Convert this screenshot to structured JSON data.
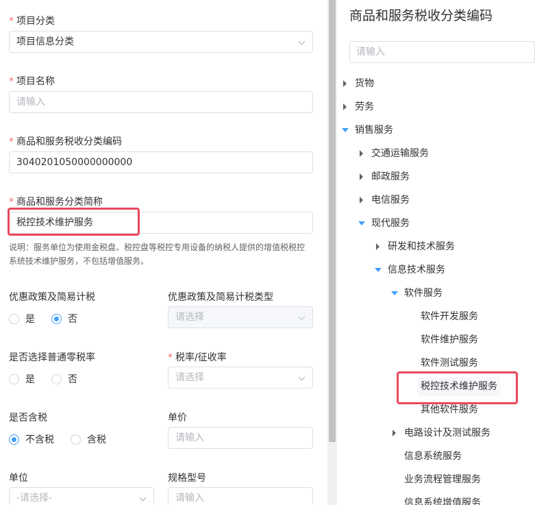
{
  "form": {
    "category": {
      "label": "项目分类",
      "value": "项目信息分类"
    },
    "name": {
      "label": "项目名称",
      "placeholder": "请输入"
    },
    "tax_code": {
      "label": "商品和服务税收分类编码",
      "value": "3040201050000000000"
    },
    "short_name": {
      "label": "商品和服务分类简称",
      "value": "税控技术维护服务"
    },
    "note": [
      "说明：服务单位为使用金税盘、税控盘等税控专用设备的纳税人提供的增值税税控",
      "系统技术维护服务，不包括增值服务。"
    ],
    "preferential": {
      "label": "优惠政策及简易计税",
      "options": [
        "是",
        "否"
      ],
      "selected": "否"
    },
    "preferential_type": {
      "label": "优惠政策及简易计税类型",
      "placeholder": "请选择"
    },
    "zero_rate": {
      "label": "是否选择普通零税率",
      "options": [
        "是",
        "否"
      ],
      "selected": ""
    },
    "tax_rate": {
      "label": "税率/征收率",
      "placeholder": "请选择"
    },
    "tax_included": {
      "label": "是否含税",
      "options": [
        "不含税",
        "含税"
      ],
      "selected": "不含税"
    },
    "unit_price": {
      "label": "单价",
      "placeholder": "请输入"
    },
    "unit": {
      "label": "单位",
      "placeholder": "-请选择-"
    },
    "spec": {
      "label": "规格型号",
      "placeholder": "请输入"
    }
  },
  "tree_panel": {
    "title": "商品和服务税收分类编码",
    "search_placeholder": "请输入",
    "nodes": [
      {
        "label": "货物",
        "level": 0,
        "state": "collapsed"
      },
      {
        "label": "劳务",
        "level": 0,
        "state": "collapsed"
      },
      {
        "label": "销售服务",
        "level": 0,
        "state": "expanded"
      },
      {
        "label": "交通运输服务",
        "level": 1,
        "state": "collapsed"
      },
      {
        "label": "邮政服务",
        "level": 1,
        "state": "collapsed"
      },
      {
        "label": "电信服务",
        "level": 1,
        "state": "collapsed"
      },
      {
        "label": "现代服务",
        "level": 1,
        "state": "expanded"
      },
      {
        "label": "研发和技术服务",
        "level": 2,
        "state": "collapsed"
      },
      {
        "label": "信息技术服务",
        "level": 2,
        "state": "expanded"
      },
      {
        "label": "软件服务",
        "level": 3,
        "state": "expanded"
      },
      {
        "label": "软件开发服务",
        "level": 4,
        "state": "leaf"
      },
      {
        "label": "软件维护服务",
        "level": 4,
        "state": "leaf"
      },
      {
        "label": "软件测试服务",
        "level": 4,
        "state": "leaf"
      },
      {
        "label": "税控技术维护服务",
        "level": 4,
        "state": "leaf",
        "selected": true
      },
      {
        "label": "其他软件服务",
        "level": 4,
        "state": "leaf"
      },
      {
        "label": "电路设计及测试服务",
        "level": 3,
        "state": "collapsed"
      },
      {
        "label": "信息系统服务",
        "level": 3,
        "state": "leaf"
      },
      {
        "label": "业务流程管理服务",
        "level": 3,
        "state": "leaf"
      },
      {
        "label": "信息系统增值服务",
        "level": 3,
        "state": "leaf"
      }
    ]
  },
  "colors": {
    "primary": "#409eff",
    "required": "#f56c6c",
    "highlight": "#e8485d"
  }
}
